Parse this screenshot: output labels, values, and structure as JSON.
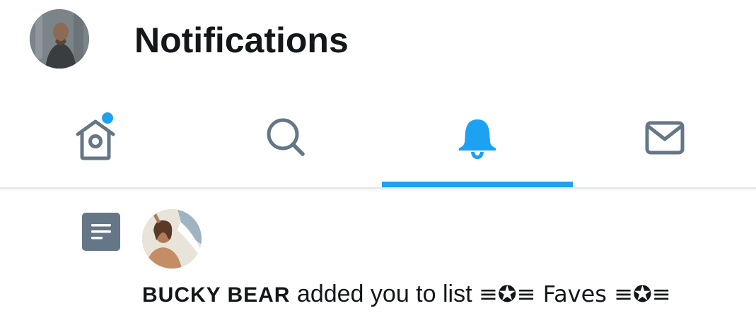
{
  "header": {
    "title": "Notifications",
    "profile_avatar": "user-avatar"
  },
  "tabs": [
    {
      "name": "home",
      "icon": "home-icon",
      "has_badge": true
    },
    {
      "name": "search",
      "icon": "search-icon",
      "has_badge": false
    },
    {
      "name": "notifications",
      "icon": "bell-icon",
      "active": true
    },
    {
      "name": "messages",
      "icon": "mail-icon",
      "has_badge": false
    }
  ],
  "colors": {
    "accent": "#1da1f2",
    "icon_inactive": "#657786",
    "text_primary": "#14171a",
    "divider": "#e1e8ed"
  },
  "notification": {
    "type_icon": "list-icon",
    "actor_name": "BUCKY BEAR",
    "action_text": " added you to list ",
    "list_name": "≡✪≡ Faves ≡✪≡"
  }
}
